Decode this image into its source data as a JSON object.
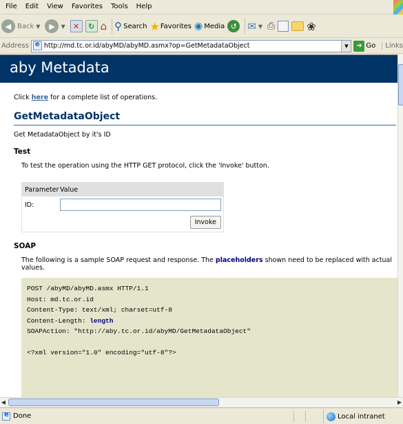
{
  "menu": [
    "File",
    "Edit",
    "View",
    "Favorites",
    "Tools",
    "Help"
  ],
  "toolbar": {
    "back": "Back",
    "search": "Search",
    "favorites": "Favorites",
    "media": "Media"
  },
  "address": {
    "label": "Address",
    "url": "http://md.tc.or.id/abyMD/abyMD.asmx?op=GetMetadataObject",
    "go": "Go",
    "links": "Links"
  },
  "page": {
    "banner": "aby Metadata",
    "intro_pre": "Click ",
    "intro_link": "here",
    "intro_post": " for a complete list of operations.",
    "op_name": "GetMetadataObject",
    "op_desc": "Get MetadataObject by it's ID",
    "test_heading": "Test",
    "test_text": "To test the operation using the HTTP GET protocol, click the 'Invoke' button.",
    "param_col": "Parameter",
    "value_col": "Value",
    "id_label": "ID:",
    "id_value": "",
    "invoke": "Invoke",
    "soap_heading": "SOAP",
    "soap_pre": "The following is a sample SOAP request and response. The ",
    "soap_placeholders": "placeholders",
    "soap_post": " shown need to be replaced with actual values.",
    "code": {
      "line1": "POST /abyMD/abyMD.asmx HTTP/1.1",
      "line2": "Host: md.tc.or.id",
      "line3": "Content-Type: text/xml; charset=utf-8",
      "line4_pre": "Content-Length: ",
      "line4_val": "length",
      "line5": "SOAPAction: \"http://aby.tc.or.id/abyMD/GetMetadataObject\"",
      "line7": "<?xml version=\"1.0\" encoding=\"utf-8\"?>"
    }
  },
  "status": {
    "text": "Done",
    "zone": "Local intranet"
  }
}
